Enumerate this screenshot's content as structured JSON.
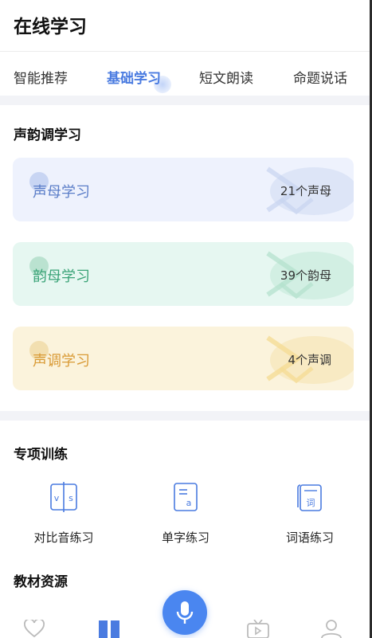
{
  "header": {
    "title": "在线学习"
  },
  "tabs": [
    {
      "label": "智能推荐",
      "active": false
    },
    {
      "label": "基础学习",
      "active": true
    },
    {
      "label": "短文朗读",
      "active": false
    },
    {
      "label": "命题说话",
      "active": false
    }
  ],
  "tone_section": {
    "title": "声韵调学习",
    "cards": [
      {
        "label": "声母学习",
        "count": "21个声母"
      },
      {
        "label": "韵母学习",
        "count": "39个韵母"
      },
      {
        "label": "声调学习",
        "count": "4个声调"
      }
    ]
  },
  "training_section": {
    "title": "专项训练",
    "items": [
      {
        "label": "对比音练习",
        "icon": "vs-compare-icon",
        "icon_text_left": "v",
        "icon_text_right": "s"
      },
      {
        "label": "单字练习",
        "icon": "single-char-icon",
        "icon_text": "a"
      },
      {
        "label": "词语练习",
        "icon": "word-icon",
        "icon_text": "词"
      }
    ]
  },
  "materials_section": {
    "title": "教材资源"
  },
  "bottom_nav": {
    "items": [
      "heart-icon",
      "book-icon",
      "tv-icon",
      "profile-icon"
    ],
    "center": "microphone-icon"
  },
  "colors": {
    "accent": "#4a7be0",
    "mic_button": "#4a86f0",
    "card_blue": "#eef2fd",
    "card_green": "#e6f7f1",
    "card_yellow": "#fbf3dc"
  }
}
